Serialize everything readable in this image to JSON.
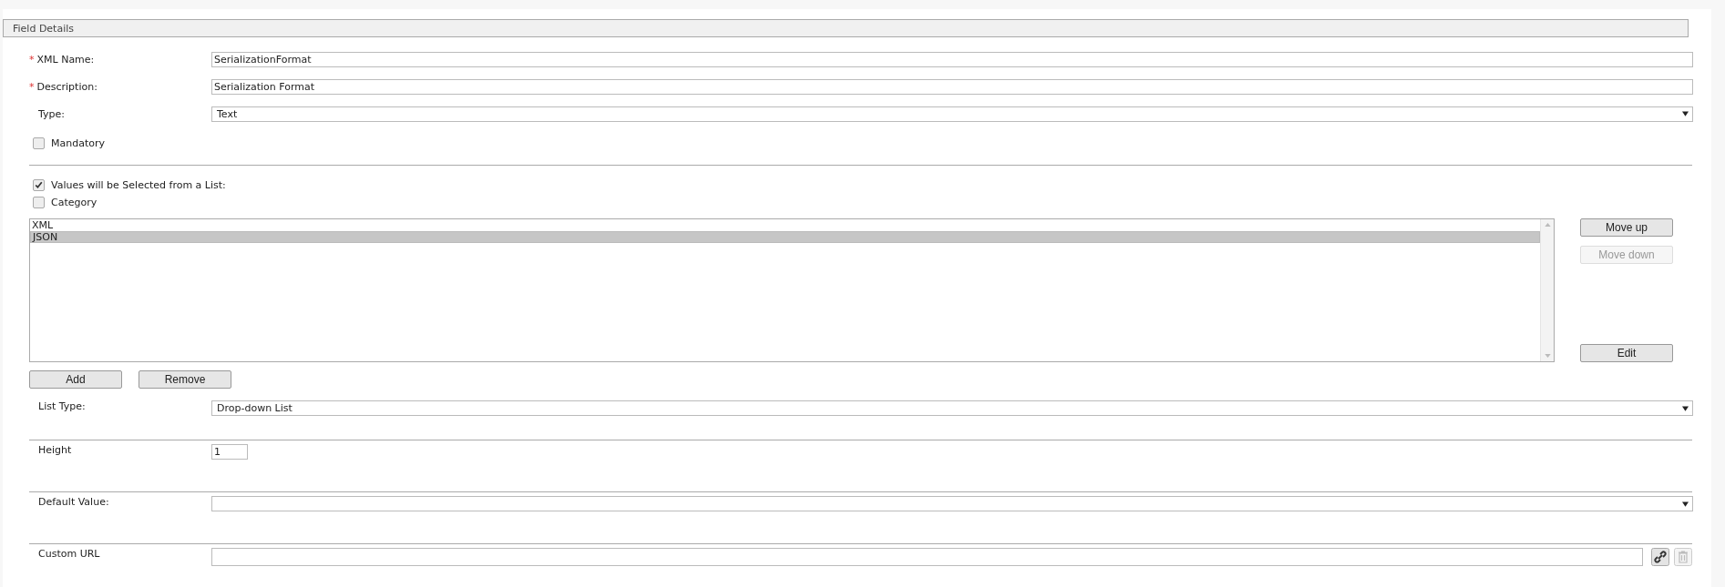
{
  "panel": {
    "title": "Field Details"
  },
  "xml_name": {
    "marker": "*",
    "label": "XML Name:",
    "value": "SerializationFormat"
  },
  "description": {
    "marker": "*",
    "label": "Description:",
    "value": "Serialization Format"
  },
  "type": {
    "label": "Type:",
    "value": "Text"
  },
  "mandatory": {
    "label": "Mandatory",
    "checked": false
  },
  "values_from_list": {
    "label": "Values will be Selected from a List:",
    "checked": true
  },
  "category": {
    "label": "Category",
    "checked": false
  },
  "list_items": [
    {
      "text": "XML",
      "selected": false
    },
    {
      "text": "JSON",
      "selected": true
    }
  ],
  "list_buttons": [
    {
      "label": "Move up",
      "disabled": false
    },
    {
      "label": "Move down",
      "disabled": true
    }
  ],
  "edit_button": {
    "label": "Edit"
  },
  "add_button": {
    "label": "Add"
  },
  "remove_button": {
    "label": "Remove"
  },
  "list_type": {
    "label": "List Type:",
    "value": "Drop-down List"
  },
  "height": {
    "label": "Height",
    "value": "1"
  },
  "default_value": {
    "label": "Default Value:"
  },
  "custom_url": {
    "label": "Custom URL"
  }
}
